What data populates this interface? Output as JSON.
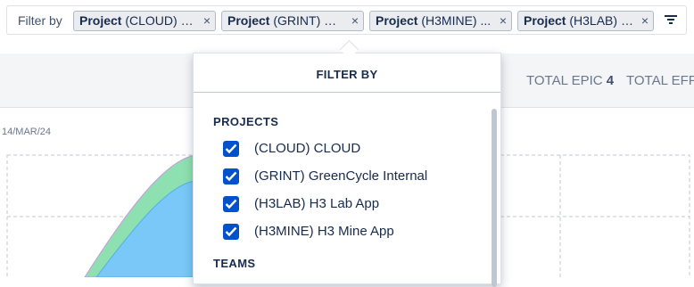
{
  "filter_bar": {
    "label": "Filter by",
    "chips": [
      {
        "key": "Project",
        "value": "(CLOUD) C..."
      },
      {
        "key": "Project",
        "value": "(GRINT) Gr..."
      },
      {
        "key": "Project",
        "value": "(H3MINE) ..."
      },
      {
        "key": "Project",
        "value": "(H3LAB) H..."
      }
    ],
    "remove_glyph": "×"
  },
  "summary": {
    "total_epic_label": "TOTAL EPIC",
    "total_epic_value": "4",
    "total_effort_label": "TOTAL EFF"
  },
  "chart": {
    "date_label": "14/MAR/24",
    "colors": {
      "green": "#8fe0b0",
      "blue": "#79c8f7",
      "grid": "#c1c7d0"
    }
  },
  "popup": {
    "title": "FILTER BY",
    "projects_heading": "PROJECTS",
    "projects": [
      {
        "label": "(CLOUD) CLOUD",
        "checked": true
      },
      {
        "label": "(GRINT) GreenCycle Internal",
        "checked": true
      },
      {
        "label": "(H3LAB) H3 Lab App",
        "checked": true
      },
      {
        "label": "(H3MINE) H3 Mine App",
        "checked": true
      }
    ],
    "teams_heading": "TEAMS"
  },
  "colors": {
    "checkbox": "#0052cc",
    "text": "#172b4d"
  }
}
